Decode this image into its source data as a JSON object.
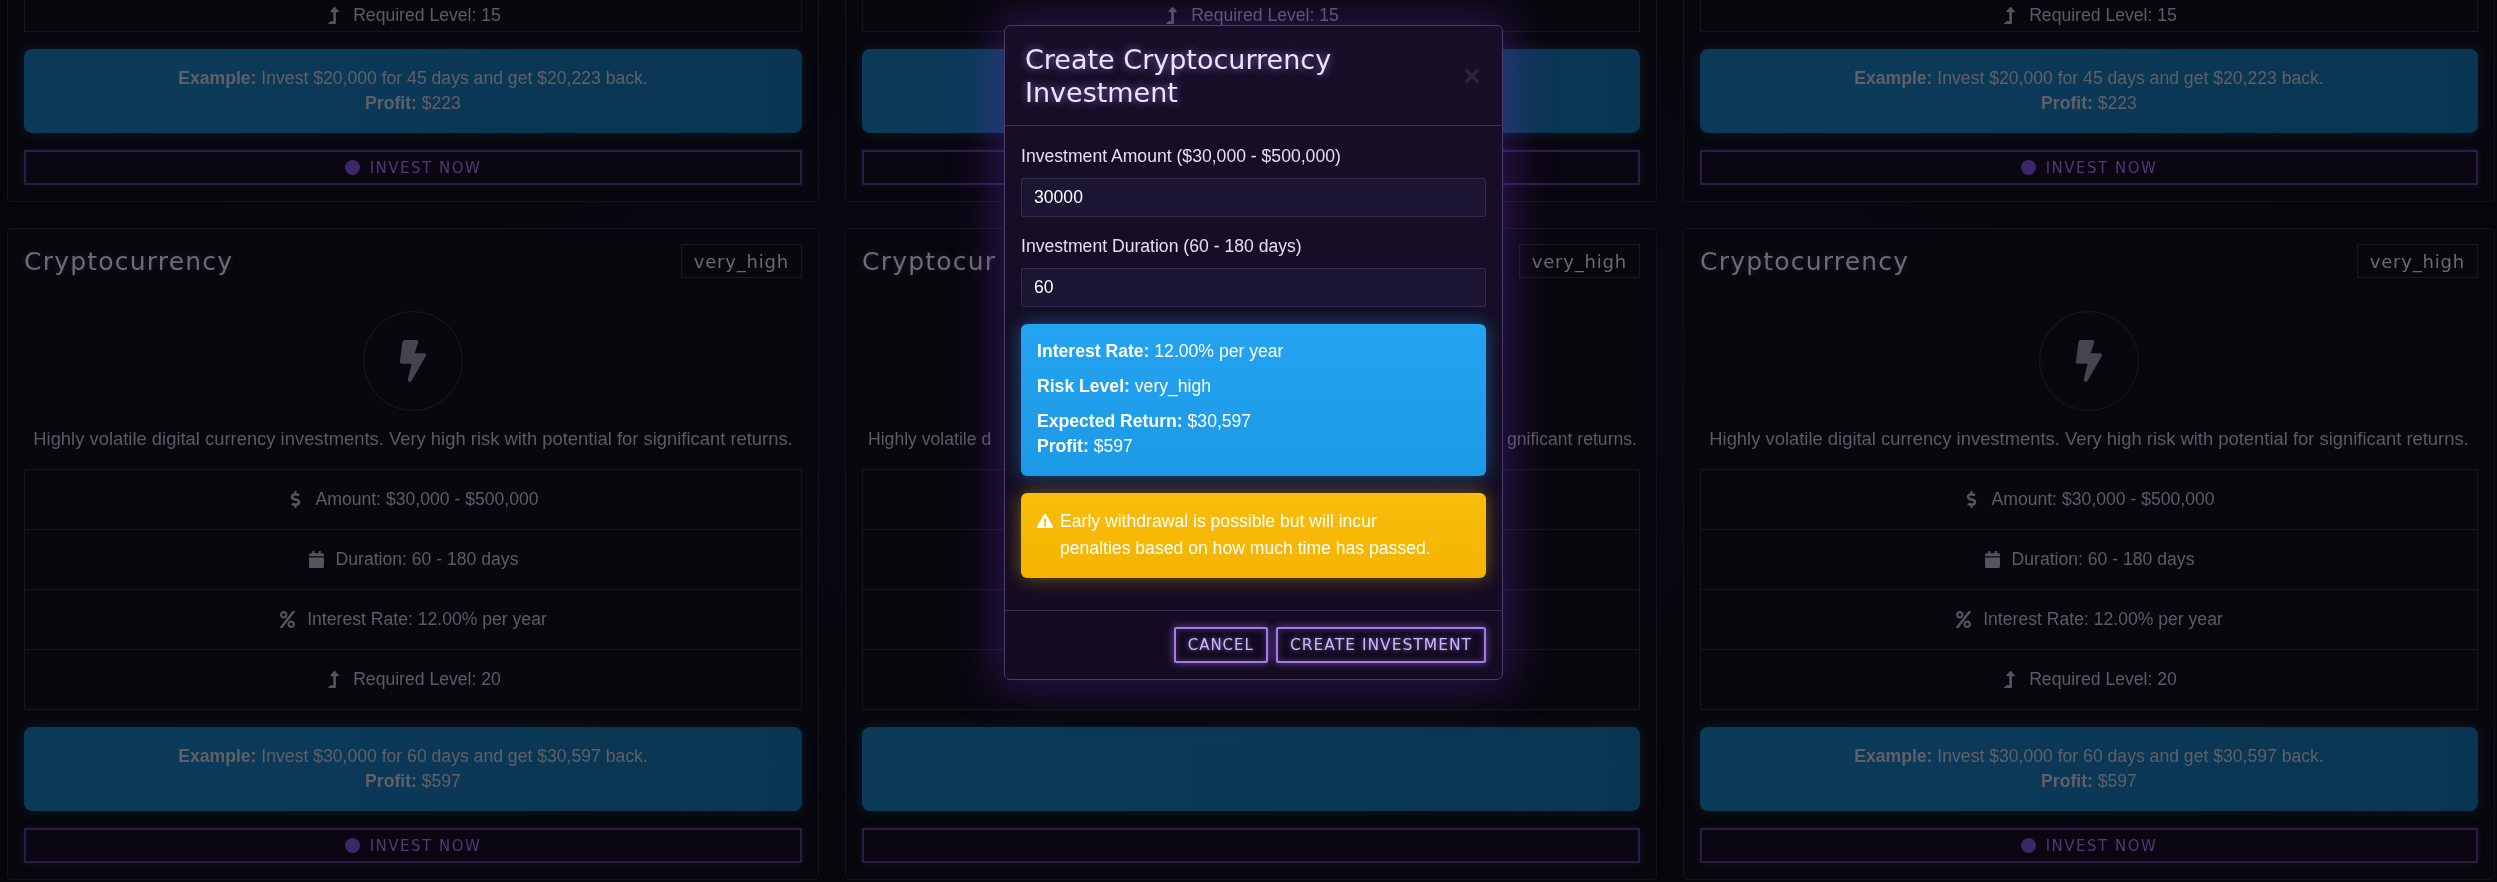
{
  "top_cards": [
    {
      "details": [
        {
          "kind": "level",
          "text": "Required Level: 15"
        }
      ],
      "example": {
        "text": "**Example:** Invest $20,000 for 45 days and get $20,223 back.",
        "profit": "**Profit:** $223"
      },
      "button": {
        "label": "INVEST NOW"
      }
    },
    {
      "details": [
        {
          "kind": "level",
          "text": "Required Level: 15"
        }
      ]
    },
    {
      "details": [
        {
          "kind": "level",
          "text": "Required Level: 15"
        }
      ],
      "example": {
        "text": "**Example:** Invest $20,000 for 45 days and get $20,223 back.",
        "profit": "**Profit:** $223"
      },
      "button": {
        "label": "INVEST NOW"
      }
    }
  ],
  "cards": [
    {
      "title": "Cryptocurrency",
      "risk": "very_high",
      "description": "Highly volatile digital currency investments. Very high risk with potential for significant returns.",
      "details": [
        {
          "kind": "amount",
          "text": "Amount: $30,000 - $500,000"
        },
        {
          "kind": "duration",
          "text": "Duration: 60 - 180 days"
        },
        {
          "kind": "rate",
          "text": "Interest Rate: 12.00% per year"
        },
        {
          "kind": "level",
          "text": "Required Level: 20"
        }
      ],
      "example": {
        "text": "**Example:** Invest $30,000 for 60 days and get $30,597 back.",
        "profit": "**Profit:** $597"
      },
      "button": {
        "label": "INVEST NOW"
      }
    },
    {
      "covered": true,
      "title": "Cryptocur",
      "risk": "very_high",
      "description_parts": [
        "Highly volatile d",
        "gnificant returns."
      ]
    },
    {
      "title": "Cryptocurrency",
      "risk": "very_high",
      "description": "Highly volatile digital currency investments. Very high risk with potential for significant returns.",
      "details": [
        {
          "kind": "amount",
          "text": "Amount: $30,000 - $500,000"
        },
        {
          "kind": "duration",
          "text": "Duration: 60 - 180 days"
        },
        {
          "kind": "rate",
          "text": "Interest Rate: 12.00% per year"
        },
        {
          "kind": "level",
          "text": "Required Level: 20"
        }
      ],
      "example": {
        "text": "**Example:** Invest $30,000 for 60 days and get $30,597 back.",
        "profit": "**Profit:** $597"
      },
      "button": {
        "label": "INVEST NOW"
      }
    }
  ],
  "modal": {
    "title": "Create Cryptocurrency Investment",
    "fields": [
      {
        "label": "Investment Amount ($30,000 - $500,000)",
        "value": "30000"
      },
      {
        "label": "Investment Duration (60 - 180 days)",
        "value": "60"
      }
    ],
    "summary": [
      {
        "lines": [
          "**Interest Rate:** 12.00% per year"
        ]
      },
      {
        "lines": [
          "**Risk Level:** very_high"
        ]
      },
      {
        "lines": [
          "**Expected Return:** $30,597",
          "**Profit:** $597"
        ]
      }
    ],
    "warning": "Early withdrawal is possible but will incur penalties based on how much time has passed.",
    "buttons": [
      {
        "kind": "cancel",
        "label": "CANCEL"
      },
      {
        "kind": "submit",
        "label": "CREATE INVESTMENT"
      }
    ]
  }
}
